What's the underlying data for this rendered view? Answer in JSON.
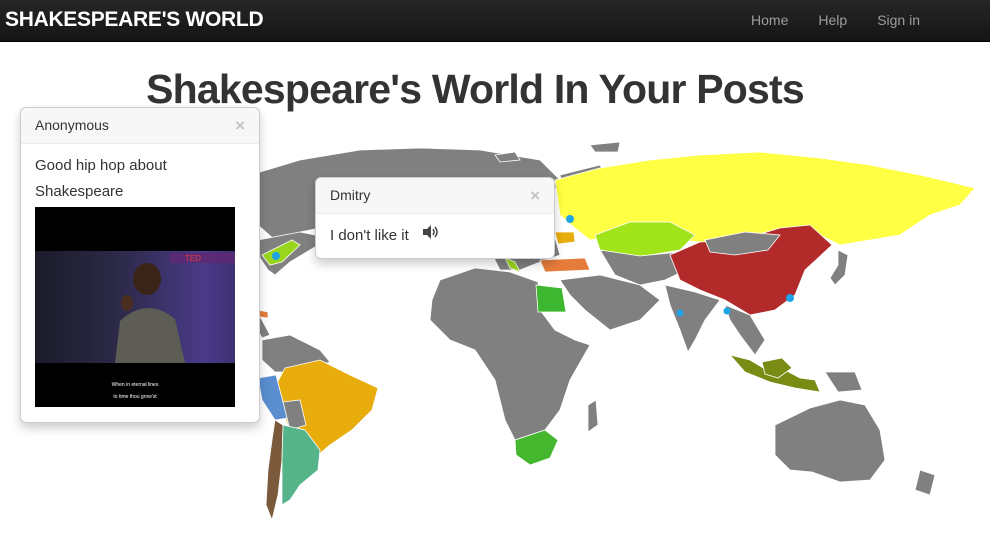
{
  "navbar": {
    "brand": "SHAKESPEARE'S WORLD",
    "links": [
      "Home",
      "Help",
      "Sign in"
    ]
  },
  "page": {
    "title": "Shakespeare's World In Your Posts"
  },
  "popovers": [
    {
      "author": "Anonymous",
      "text": "Good hip hop about Shakespeare",
      "video": {
        "caption_line1": "When in eternal lines",
        "caption_line2": "to time thou grow'st"
      }
    },
    {
      "author": "Dmitry",
      "text": "I don't like it"
    }
  ],
  "icons": {
    "close": "close-icon",
    "speaker": "speaker-icon"
  },
  "colors": {
    "navbar": "#1b1b1b",
    "land_default": "#808080",
    "russia": "#ffff44",
    "china": "#b22a2a",
    "brazil": "#e8ad0d",
    "kazakhstan": "#a1e41a",
    "egypt": "#3cb72f",
    "south_africa": "#44b72f",
    "argentina": "#55b48a",
    "marker": "#1ea4e8"
  }
}
